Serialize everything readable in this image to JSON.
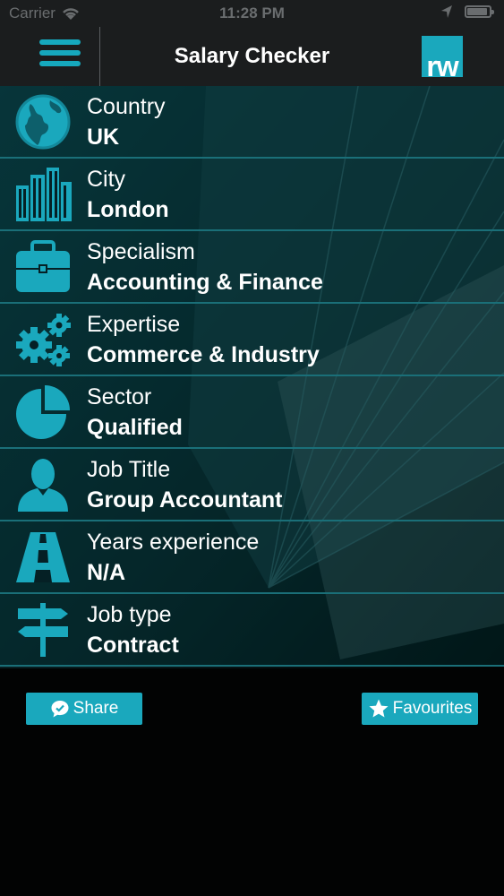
{
  "status": {
    "carrier": "Carrier",
    "time": "11:28 PM"
  },
  "nav": {
    "title": "Salary Checker",
    "logo_text": "rw"
  },
  "rows": [
    {
      "label": "Country",
      "value": "UK",
      "icon": "globe-icon"
    },
    {
      "label": "City",
      "value": "London",
      "icon": "buildings-icon"
    },
    {
      "label": "Specialism",
      "value": "Accounting & Finance",
      "icon": "briefcase-icon"
    },
    {
      "label": "Expertise",
      "value": "Commerce & Industry",
      "icon": "gears-icon"
    },
    {
      "label": "Sector",
      "value": "Qualified",
      "icon": "pie-chart-icon"
    },
    {
      "label": "Job Title",
      "value": "Group Accountant",
      "icon": "person-icon"
    },
    {
      "label": "Years experience",
      "value": "N/A",
      "icon": "road-icon"
    },
    {
      "label": "Job type",
      "value": "Contract",
      "icon": "signpost-icon"
    }
  ],
  "buttons": {
    "share": "Share",
    "favourites": "Favourites"
  },
  "colors": {
    "accent": "#1aa8bd",
    "bar_background": "#1b1d1e",
    "row_divider": "#1a6f78"
  }
}
